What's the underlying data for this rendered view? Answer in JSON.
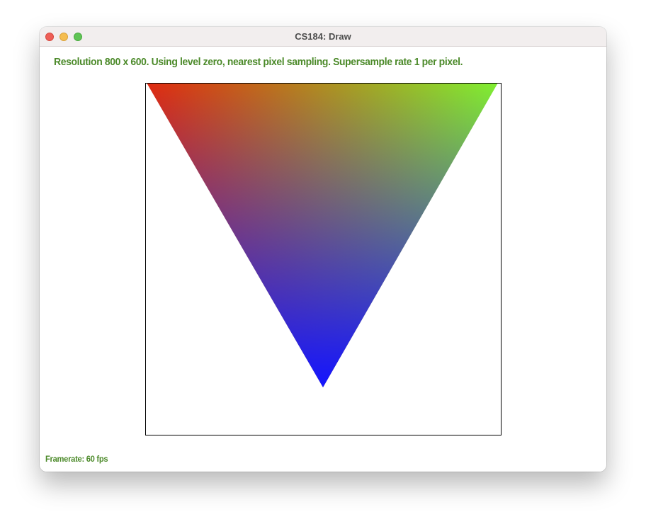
{
  "window": {
    "title": "CS184: Draw"
  },
  "hud": {
    "status": "Resolution 800 x 600. Using level zero, nearest pixel sampling. Supersample rate 1 per pixel.",
    "framerate": "Framerate: 60 fps",
    "text_color": "#4c8a2a"
  },
  "triangle": {
    "vertex_colors": {
      "top_left": "#e02a10",
      "top_right": "#80f030",
      "bottom": "#1414ff"
    }
  }
}
